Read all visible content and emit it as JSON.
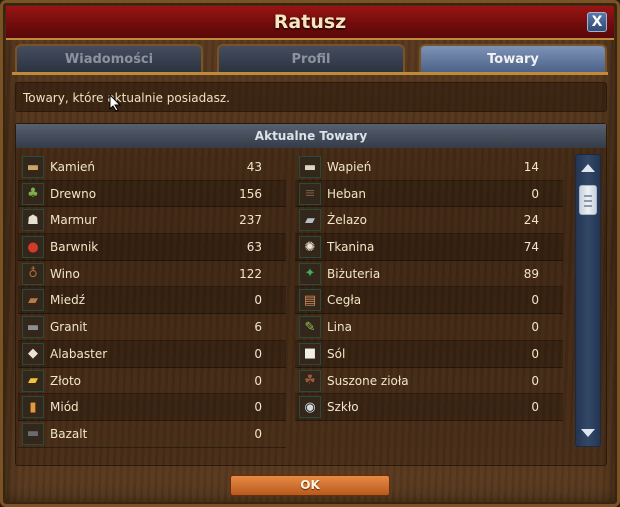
{
  "window": {
    "title": "Ratusz",
    "close_label": "X"
  },
  "tabs": [
    {
      "label": "Wiadomości"
    },
    {
      "label": "Profil"
    },
    {
      "label": "Towary"
    }
  ],
  "info": {
    "text": "Towary, które aktualnie posiadasz."
  },
  "panel": {
    "header": "Aktualne Towary"
  },
  "goods_left": [
    {
      "name": "Kamień",
      "value": "43",
      "icon": "stone-icon"
    },
    {
      "name": "Drewno",
      "value": "156",
      "icon": "wood-icon"
    },
    {
      "name": "Marmur",
      "value": "237",
      "icon": "marble-icon"
    },
    {
      "name": "Barwnik",
      "value": "63",
      "icon": "dye-icon"
    },
    {
      "name": "Wino",
      "value": "122",
      "icon": "wine-icon"
    },
    {
      "name": "Miedź",
      "value": "0",
      "icon": "copper-icon"
    },
    {
      "name": "Granit",
      "value": "6",
      "icon": "granite-icon"
    },
    {
      "name": "Alabaster",
      "value": "0",
      "icon": "alabaster-icon"
    },
    {
      "name": "Złoto",
      "value": "0",
      "icon": "gold-icon"
    },
    {
      "name": "Miód",
      "value": "0",
      "icon": "honey-icon"
    },
    {
      "name": "Bazalt",
      "value": "0",
      "icon": "basalt-icon"
    }
  ],
  "goods_right": [
    {
      "name": "Wapień",
      "value": "14",
      "icon": "limestone-icon"
    },
    {
      "name": "Heban",
      "value": "0",
      "icon": "ebony-icon"
    },
    {
      "name": "Żelazo",
      "value": "24",
      "icon": "iron-icon"
    },
    {
      "name": "Tkanina",
      "value": "74",
      "icon": "cloth-icon"
    },
    {
      "name": "Biżuteria",
      "value": "89",
      "icon": "jewelry-icon"
    },
    {
      "name": "Cegła",
      "value": "0",
      "icon": "brick-icon"
    },
    {
      "name": "Lina",
      "value": "0",
      "icon": "rope-icon"
    },
    {
      "name": "Sól",
      "value": "0",
      "icon": "salt-icon"
    },
    {
      "name": "Suszone zioła",
      "value": "0",
      "icon": "herbs-icon"
    },
    {
      "name": "Szkło",
      "value": "0",
      "icon": "glass-icon"
    }
  ],
  "ok_label": "OK",
  "colors": {
    "accent": "#c08a3a",
    "title_bar": "#8a1010",
    "tab_active": "#6b80a6",
    "ok_button": "#d0702f"
  }
}
